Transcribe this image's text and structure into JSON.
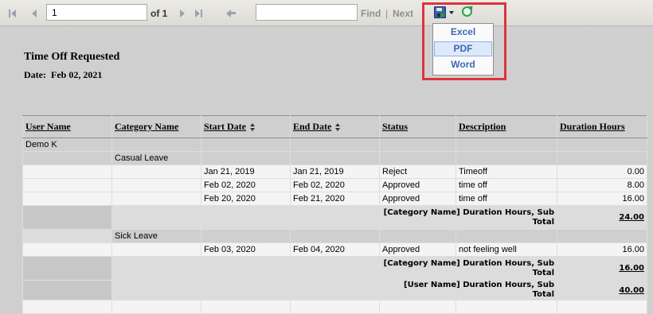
{
  "toolbar": {
    "page_value": "1",
    "of_label": "of 1",
    "find_value": "",
    "find_label": "Find",
    "separator": "|",
    "next_label": "Next"
  },
  "export_menu": {
    "items": [
      "Excel",
      "PDF",
      "Word"
    ],
    "highlighted": "PDF"
  },
  "report": {
    "title": "Time Off Requested",
    "date_label": "Date:",
    "date_value": "Feb 02, 2021",
    "columns": [
      "User Name",
      "Category Name",
      "Start Date",
      "End Date",
      "Status",
      "Description",
      "Duration Hours"
    ],
    "user": "Demo K",
    "groups": [
      {
        "category": "Casual Leave",
        "rows": [
          {
            "start": "Jan 21, 2019",
            "end": "Jan 21, 2019",
            "status": "Reject",
            "description": "Timeoff",
            "hours": "0.00"
          },
          {
            "start": "Feb 02, 2020",
            "end": "Feb 02, 2020",
            "status": "Approved",
            "description": "time off",
            "hours": "8.00"
          },
          {
            "start": "Feb 20, 2020",
            "end": "Feb 21, 2020",
            "status": "Approved",
            "description": "time off",
            "hours": "16.00"
          }
        ],
        "subtotal_label": "[Category Name] Duration Hours, Sub Total",
        "subtotal": "24.00"
      },
      {
        "category": "Sick Leave",
        "rows": [
          {
            "start": "Feb 03, 2020",
            "end": "Feb 04, 2020",
            "status": "Approved",
            "description": "not feeling well",
            "hours": "16.00"
          }
        ],
        "subtotal_label": "[Category Name] Duration Hours, Sub Total",
        "subtotal": "16.00"
      }
    ],
    "user_total_label": "[User Name] Duration Hours, Sub Total",
    "user_total": "40.00"
  },
  "colors": {
    "highlight": "#e0333a",
    "menu_text": "#3f67b6",
    "page_bg": "#cfcfcf"
  },
  "icons": [
    "first-page-icon",
    "prev-page-icon",
    "next-page-icon",
    "last-page-icon",
    "back-icon",
    "export-icon",
    "refresh-icon",
    "sort-icon"
  ]
}
